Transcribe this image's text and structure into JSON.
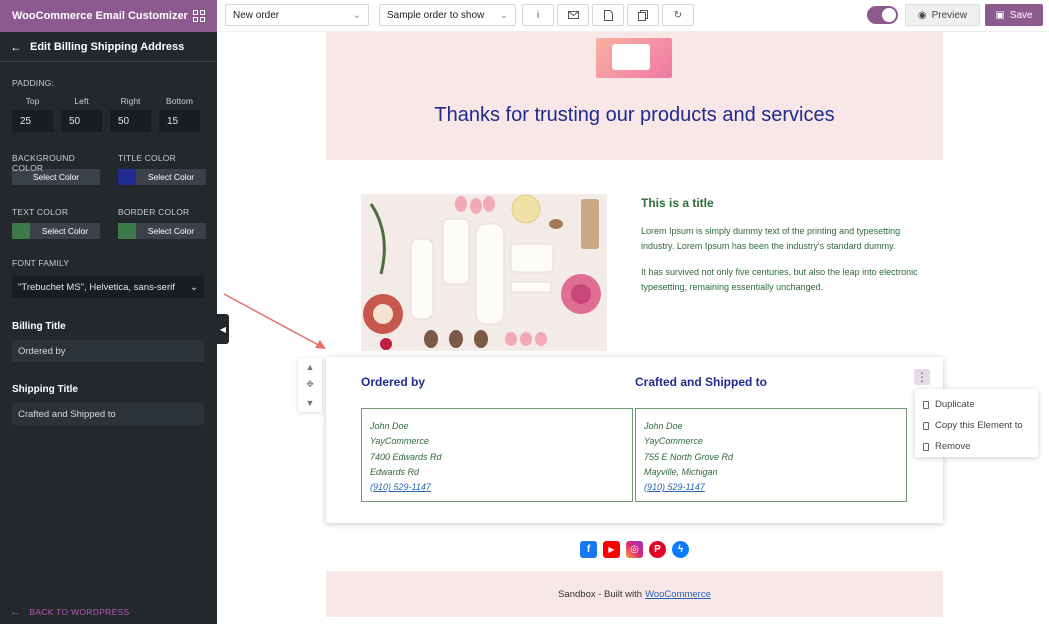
{
  "app": {
    "title": "WooCommerce Email Customizer"
  },
  "sidebar": {
    "panel_title": "Edit Billing Shipping Address",
    "padding_label": "PADDING:",
    "padding": [
      {
        "label": "Top",
        "value": "25"
      },
      {
        "label": "Left",
        "value": "50"
      },
      {
        "label": "Right",
        "value": "50"
      },
      {
        "label": "Bottom",
        "value": "15"
      }
    ],
    "colors": [
      {
        "label": "BACKGROUND COLOR",
        "button": "Select Color",
        "swatch": "#2c3338"
      },
      {
        "label": "TITLE COLOR",
        "button": "Select Color",
        "swatch": "#1f2b8f"
      },
      {
        "label": "TEXT COLOR",
        "button": "Select Color",
        "swatch": "#3c7a4a"
      },
      {
        "label": "BORDER COLOR",
        "button": "Select Color",
        "swatch": "#3c7a4a"
      }
    ],
    "font_family_label": "FONT FAMILY",
    "font_family_value": "\"Trebuchet MS\", Helvetica, sans-serif",
    "billing_title_label": "Billing Title",
    "billing_title_value": "Ordered by",
    "shipping_title_label": "Shipping Title",
    "shipping_title_value": "Crafted and Shipped to",
    "back_link": "BACK TO WORDPRESS"
  },
  "toolbar": {
    "email_type": "New order",
    "sample_order": "Sample order to show",
    "preview_label": "Preview",
    "save_label": "Save"
  },
  "email": {
    "hero_title": "Thanks for trusting our products and services",
    "product_title": "This is a title",
    "product_para1": "Lorem Ipsum is simply dummy text of the printing and typesetting industry. Lorem Ipsum has been the industry's standard dummy.",
    "product_para2": "It has survived not only five centuries, but also the leap into electronic typesetting, remaining essentially unchanged.",
    "billing_heading": "Ordered by",
    "shipping_heading": "Crafted and Shipped to",
    "billing": {
      "name": "John Doe",
      "company": "YayCommerce",
      "address1": "7400 Edwards Rd",
      "address2": "Edwards Rd",
      "phone": "(910) 529-1147"
    },
    "shipping": {
      "name": "John Doe",
      "company": "YayCommerce",
      "address1": "755 E North Grove Rd",
      "address2": "Mayville, Michigan",
      "phone": "(910) 529-1147"
    },
    "footer_text": "Sandbox - Built with",
    "footer_link": "WooCommerce"
  },
  "context_menu": {
    "items": [
      "Duplicate",
      "Copy this Element to",
      "Remove"
    ]
  },
  "colors": {
    "brand": "#8c5a8f",
    "title_blue": "#1f2b8f",
    "text_green": "#2e6b3a",
    "hero_bg": "#f8e7e6"
  }
}
